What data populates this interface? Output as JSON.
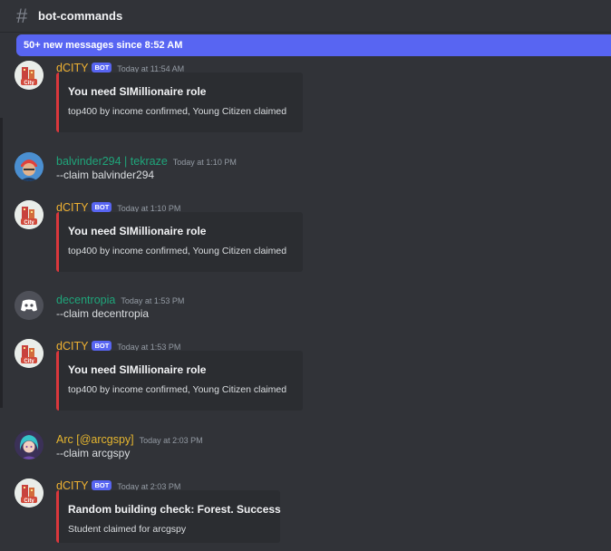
{
  "channel": {
    "name": "bot-commands",
    "icon": "hash-icon"
  },
  "banner": {
    "text": "50+ new messages since 8:52 AM"
  },
  "messages": [
    {
      "author": "dCITY",
      "bot_badge": "BOT",
      "timestamp": "Today at 11:54 AM",
      "embed": {
        "title": "You need SIMillionaire role",
        "description": "top400 by income confirmed, Young Citizen claimed"
      }
    },
    {
      "author": "balvinder294 | tekraze",
      "timestamp": "Today at 1:10 PM",
      "text": "--claim balvinder294"
    },
    {
      "author": "dCITY",
      "bot_badge": "BOT",
      "timestamp": "Today at 1:10 PM",
      "embed": {
        "title": "You need SIMillionaire role",
        "description": "top400 by income confirmed, Young Citizen claimed"
      }
    },
    {
      "author": "decentropia",
      "timestamp": "Today at 1:53 PM",
      "text": "--claim decentropia"
    },
    {
      "author": "dCITY",
      "bot_badge": "BOT",
      "timestamp": "Today at 1:53 PM",
      "embed": {
        "title": "You need SIMillionaire role",
        "description": "top400 by income confirmed, Young Citizen claimed"
      }
    },
    {
      "author": "Arc [@arcgspy]",
      "timestamp": "Today at 2:03 PM",
      "text": "--claim arcgspy"
    },
    {
      "author": "dCITY",
      "bot_badge": "BOT",
      "timestamp": "Today at 2:03 PM",
      "embed": {
        "title": "Random building check: Forest. Success",
        "description": "Student claimed for arcgspy"
      }
    }
  ],
  "colors": {
    "accent": "#5865f2",
    "embed_border": "#da373c",
    "background": "#313338",
    "embed_bg": "#2b2d31"
  }
}
